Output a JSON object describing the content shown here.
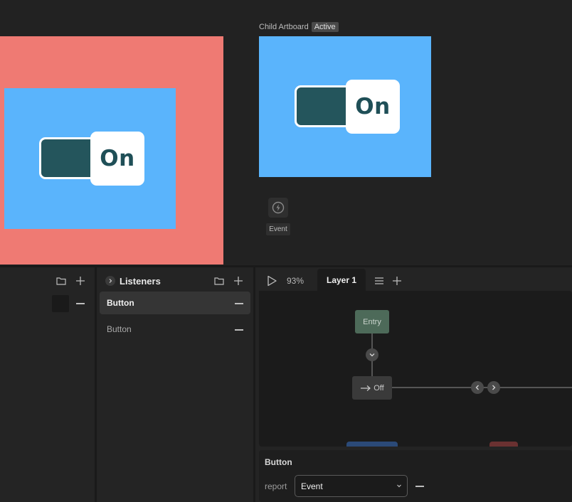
{
  "canvas": {
    "child_artboard": {
      "label": "Child Artboard",
      "badge": "Active"
    },
    "parent_toggle": {
      "text": "On"
    },
    "child_toggle": {
      "text": "On"
    },
    "event_node": {
      "label": "Event",
      "icon": "lightning-icon"
    },
    "colors": {
      "parent_background": "#ef7a73",
      "artboard_blue": "#5ab4fc",
      "toggle_track": "#24555c",
      "toggle_text": "#1f4f57"
    }
  },
  "listeners": {
    "title": "Listeners",
    "items": [
      {
        "label": "Button",
        "selected": true
      },
      {
        "label": "Button",
        "selected": false
      }
    ]
  },
  "graph": {
    "zoom": "93%",
    "layer_tab": "Layer 1",
    "nodes": {
      "entry": "Entry",
      "off": "Off"
    },
    "colors": {
      "entry_node": "#4d6a59",
      "state_node": "#3a3a3a"
    }
  },
  "properties": {
    "title": "Button",
    "report_label": "report",
    "report_value": "Event"
  }
}
